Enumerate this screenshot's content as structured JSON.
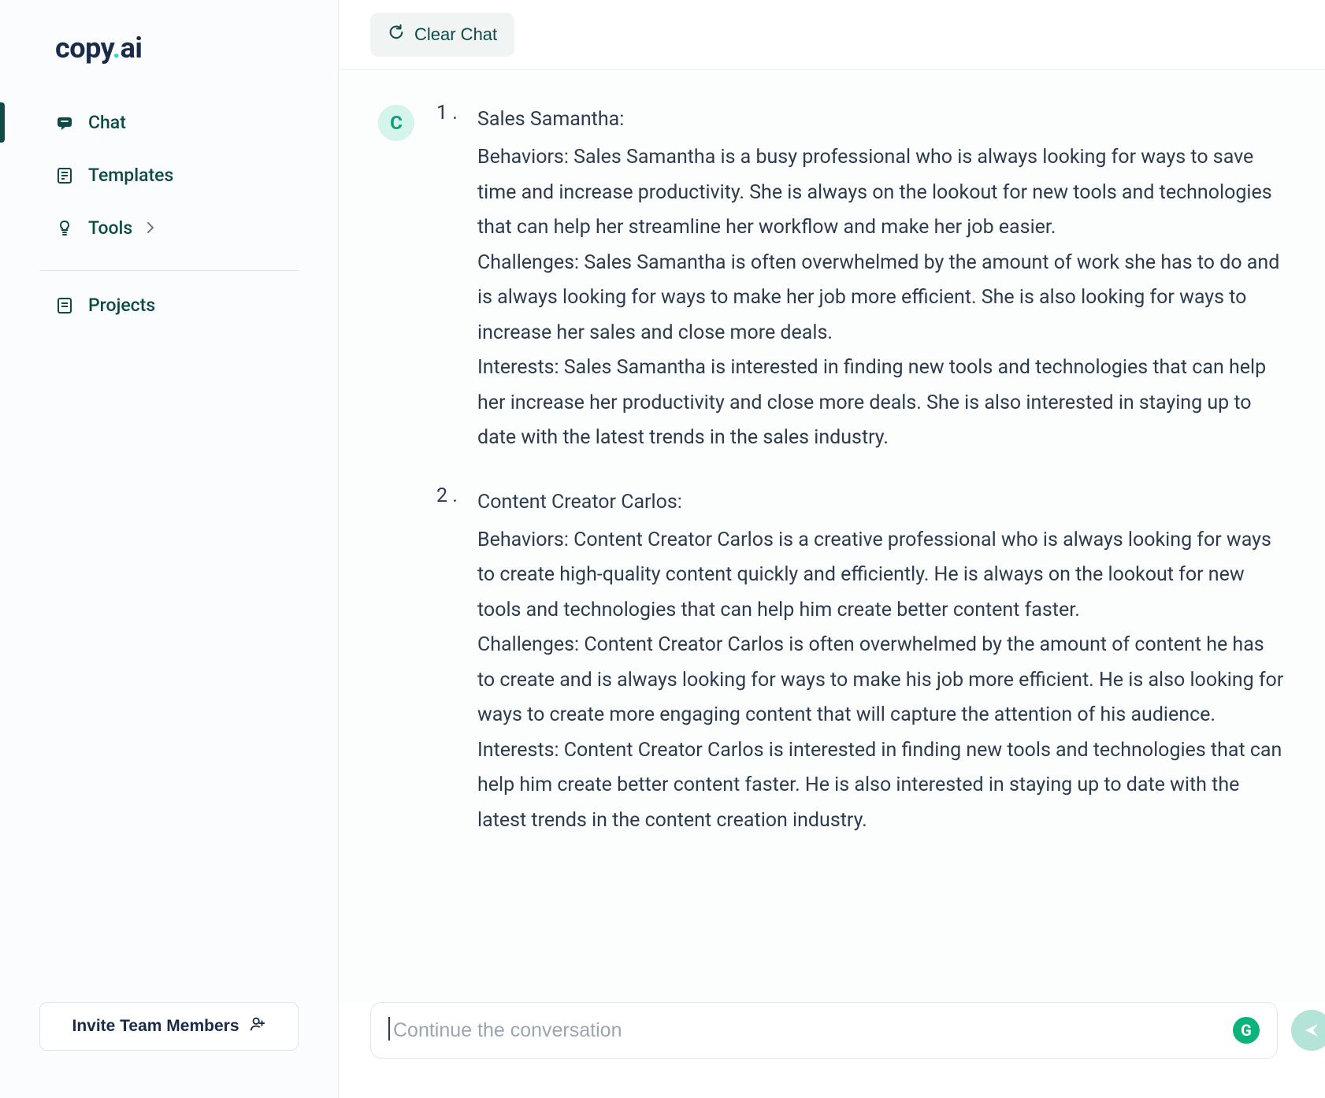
{
  "brand": {
    "prefix": "copy",
    "dot": ".",
    "suffix": "ai"
  },
  "sidebar": {
    "items": [
      {
        "label": "Chat",
        "icon": "chat-icon",
        "active": true
      },
      {
        "label": "Templates",
        "icon": "templates-icon",
        "active": false
      },
      {
        "label": "Tools",
        "icon": "tools-icon",
        "active": false,
        "hasChevron": true
      }
    ],
    "projectsLabel": "Projects",
    "inviteLabel": "Invite Team Members"
  },
  "toolbar": {
    "clearLabel": "Clear Chat"
  },
  "avatar": {
    "letter": "C"
  },
  "message": {
    "personas": [
      {
        "num": "1 .",
        "title": "Sales Samantha:",
        "behaviors": "Behaviors: Sales Samantha is a busy professional who is always looking for ways to save time and increase productivity. She is always on the lookout for new tools and technologies that can help her streamline her workflow and make her job easier.",
        "challenges": "Challenges: Sales Samantha is often overwhelmed by the amount of work she has to do and is always looking for ways to make her job more efficient. She is also looking for ways to increase her sales and close more deals.",
        "interests": "Interests: Sales Samantha is interested in finding new tools and technologies that can help her increase her productivity and close more deals. She is also interested in staying up to date with the latest trends in the sales industry."
      },
      {
        "num": "2 .",
        "title": "Content Creator Carlos:",
        "behaviors": "Behaviors: Content Creator Carlos is a creative professional who is always looking for ways to create high-quality content quickly and efficiently. He is always on the lookout for new tools and technologies that can help him create better content faster.",
        "challenges": "Challenges: Content Creator Carlos is often overwhelmed by the amount of content he has to create and is always looking for ways to make his job more efficient. He is also looking for ways to create more engaging content that will capture the attention of his audience.",
        "interests": "Interests: Content Creator Carlos is interested in finding new tools and technologies that can help him create better content faster. He is also interested in staying up to date with the latest trends in the content creation industry."
      }
    ]
  },
  "input": {
    "placeholder": "Continue the conversation"
  },
  "grammarly": {
    "letter": "G"
  }
}
